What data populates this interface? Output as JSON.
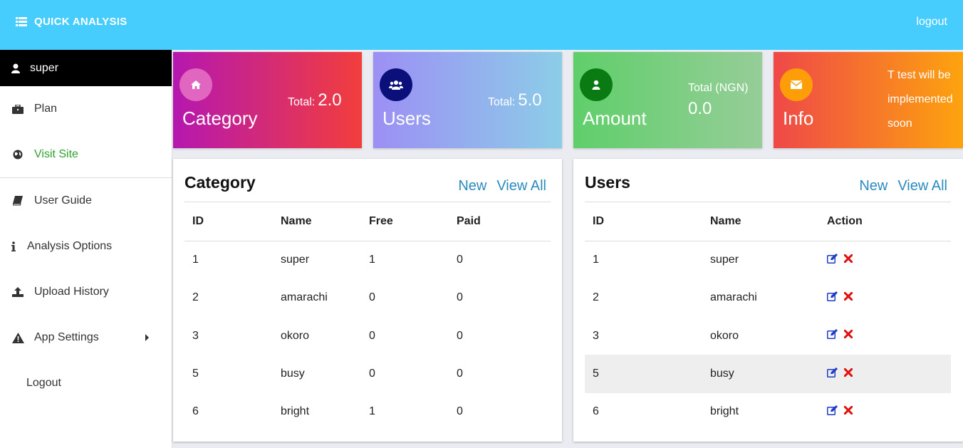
{
  "header": {
    "brand": "QUICK ANALYSIS",
    "logout": "logout"
  },
  "sidebar": {
    "user": "super",
    "items": [
      {
        "label": "Plan"
      },
      {
        "label": "Visit Site"
      },
      {
        "label": "User Guide"
      },
      {
        "label": "Analysis Options"
      },
      {
        "label": "Upload History"
      },
      {
        "label": "App Settings"
      },
      {
        "label": "Logout"
      }
    ]
  },
  "cards": [
    {
      "title": "Category",
      "total_label": "Total:",
      "total_value": "2.0",
      "color": "#d9368a"
    },
    {
      "title": "Users",
      "total_label": "Total:",
      "total_value": "5.0",
      "color": "#93b0ee"
    },
    {
      "title": "Amount",
      "total_label": "Total (NGN)",
      "total_value": "0.0",
      "color": "#7dce82"
    },
    {
      "title": "Info",
      "lines": [
        "T test will be",
        "implemented",
        "soon"
      ],
      "color": "#f77a2b"
    }
  ],
  "category_panel": {
    "title": "Category",
    "new_label": "New",
    "view_all_label": "View All",
    "columns": [
      "ID",
      "Name",
      "Free",
      "Paid"
    ],
    "rows": [
      [
        "1",
        "super",
        "1",
        "0"
      ],
      [
        "2",
        "amarachi",
        "0",
        "0"
      ],
      [
        "3",
        "okoro",
        "0",
        "0"
      ],
      [
        "5",
        "busy",
        "0",
        "0"
      ],
      [
        "6",
        "bright",
        "1",
        "0"
      ]
    ]
  },
  "users_panel": {
    "title": "Users",
    "new_label": "New",
    "view_all_label": "View All",
    "columns": [
      "ID",
      "Name",
      "Action"
    ],
    "rows": [
      [
        "1",
        "super"
      ],
      [
        "2",
        "amarachi"
      ],
      [
        "3",
        "okoro"
      ],
      [
        "5",
        "busy"
      ],
      [
        "6",
        "bright"
      ]
    ],
    "highlighted_row": 3
  },
  "colors": {
    "topbar": "#47ccfe",
    "link": "#2a8bbf",
    "edit": "#1e3cc8",
    "delete": "#e01010",
    "visit_site": "#2ea12e"
  }
}
